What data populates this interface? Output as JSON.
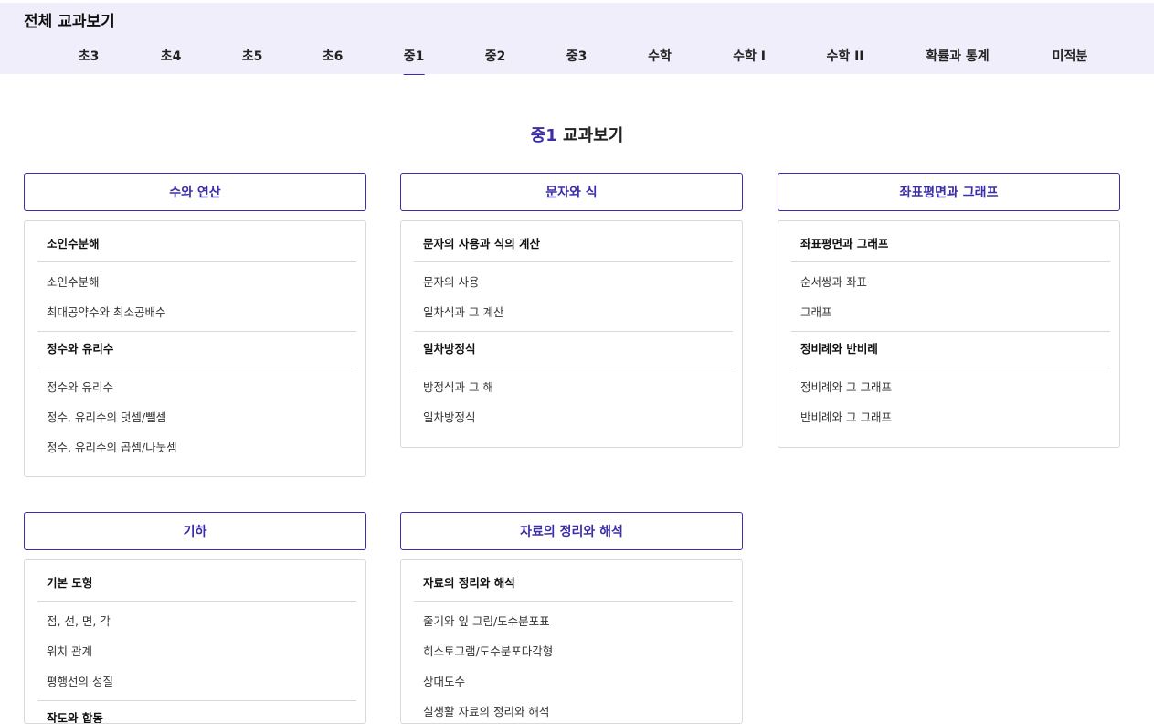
{
  "header": {
    "title": "전체 교과보기",
    "tabs": [
      {
        "label": "초3",
        "active": false
      },
      {
        "label": "초4",
        "active": false
      },
      {
        "label": "초5",
        "active": false
      },
      {
        "label": "초6",
        "active": false
      },
      {
        "label": "중1",
        "active": true
      },
      {
        "label": "중2",
        "active": false
      },
      {
        "label": "중3",
        "active": false
      },
      {
        "label": "수학",
        "active": false
      },
      {
        "label": "수학 I",
        "active": false
      },
      {
        "label": "수학 II",
        "active": false
      },
      {
        "label": "확률과 통계",
        "active": false
      },
      {
        "label": "미적분",
        "active": false
      }
    ]
  },
  "main": {
    "heading_accent": "중1",
    "heading_rest": " 교과보기",
    "cards": [
      {
        "title": "수와 연산",
        "sections": [
          {
            "title": "소인수분해",
            "items": [
              "소인수분해",
              "최대공약수와 최소공배수"
            ]
          },
          {
            "title": "정수와 유리수",
            "items": [
              "정수와 유리수",
              "정수, 유리수의 덧셈/뺄셈",
              "정수, 유리수의 곱셈/나눗셈"
            ]
          }
        ]
      },
      {
        "title": "문자와 식",
        "sections": [
          {
            "title": "문자의 사용과 식의 계산",
            "items": [
              "문자의 사용",
              "일차식과 그 계산"
            ]
          },
          {
            "title": "일차방정식",
            "items": [
              "방정식과 그 해",
              "일차방정식"
            ]
          }
        ]
      },
      {
        "title": "좌표평면과 그래프",
        "sections": [
          {
            "title": "좌표평면과 그래프",
            "items": [
              "순서쌍과 좌표",
              "그래프"
            ]
          },
          {
            "title": "정비례와 반비례",
            "items": [
              "정비례와 그 그래프",
              "반비례와 그 그래프"
            ]
          }
        ]
      },
      {
        "title": "기하",
        "sections": [
          {
            "title": "기본 도형",
            "items": [
              "점, 선, 면, 각",
              "위치 관계",
              "평행선의 성질"
            ]
          },
          {
            "title": "작도와 합동",
            "items": []
          }
        ]
      },
      {
        "title": "자료의 정리와 해석",
        "sections": [
          {
            "title": "자료의 정리와 해석",
            "items": [
              "줄기와 잎 그림/도수분포표",
              "히스토그램/도수분포다각형",
              "상대도수",
              "실생활 자료의 정리와 해석"
            ]
          }
        ]
      }
    ]
  },
  "colors": {
    "accent": "#3b2ea8",
    "header_bg": "#f0eefb",
    "border": "#d9d9d9"
  }
}
